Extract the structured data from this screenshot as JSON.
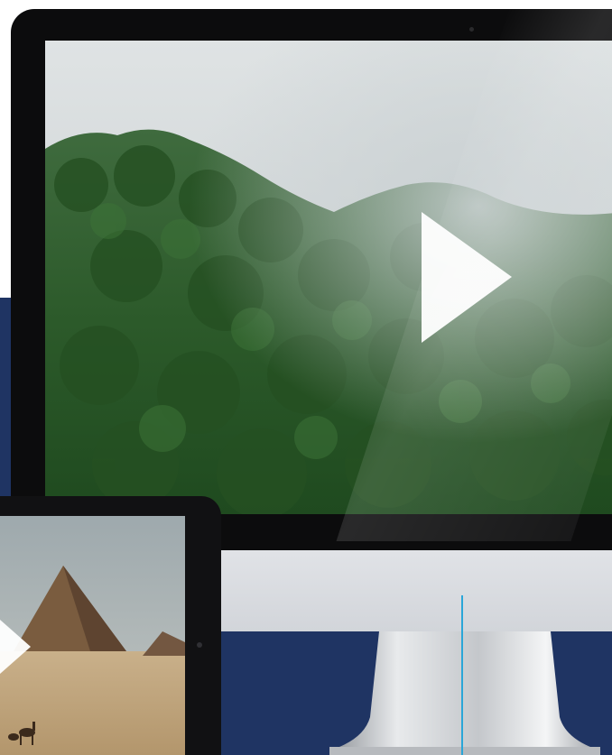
{
  "scene": {
    "description_free": true,
    "colors": {
      "background_white": "#ffffff",
      "brand_navy": "#1f3463",
      "device_bezel": "#0c0c0d",
      "accent_line": "#2aa6d8",
      "play_icon": "#ffffff"
    }
  },
  "monitor": {
    "icons": [
      "play-icon"
    ]
  },
  "tablet": {
    "icons": [
      "play-icon"
    ]
  }
}
